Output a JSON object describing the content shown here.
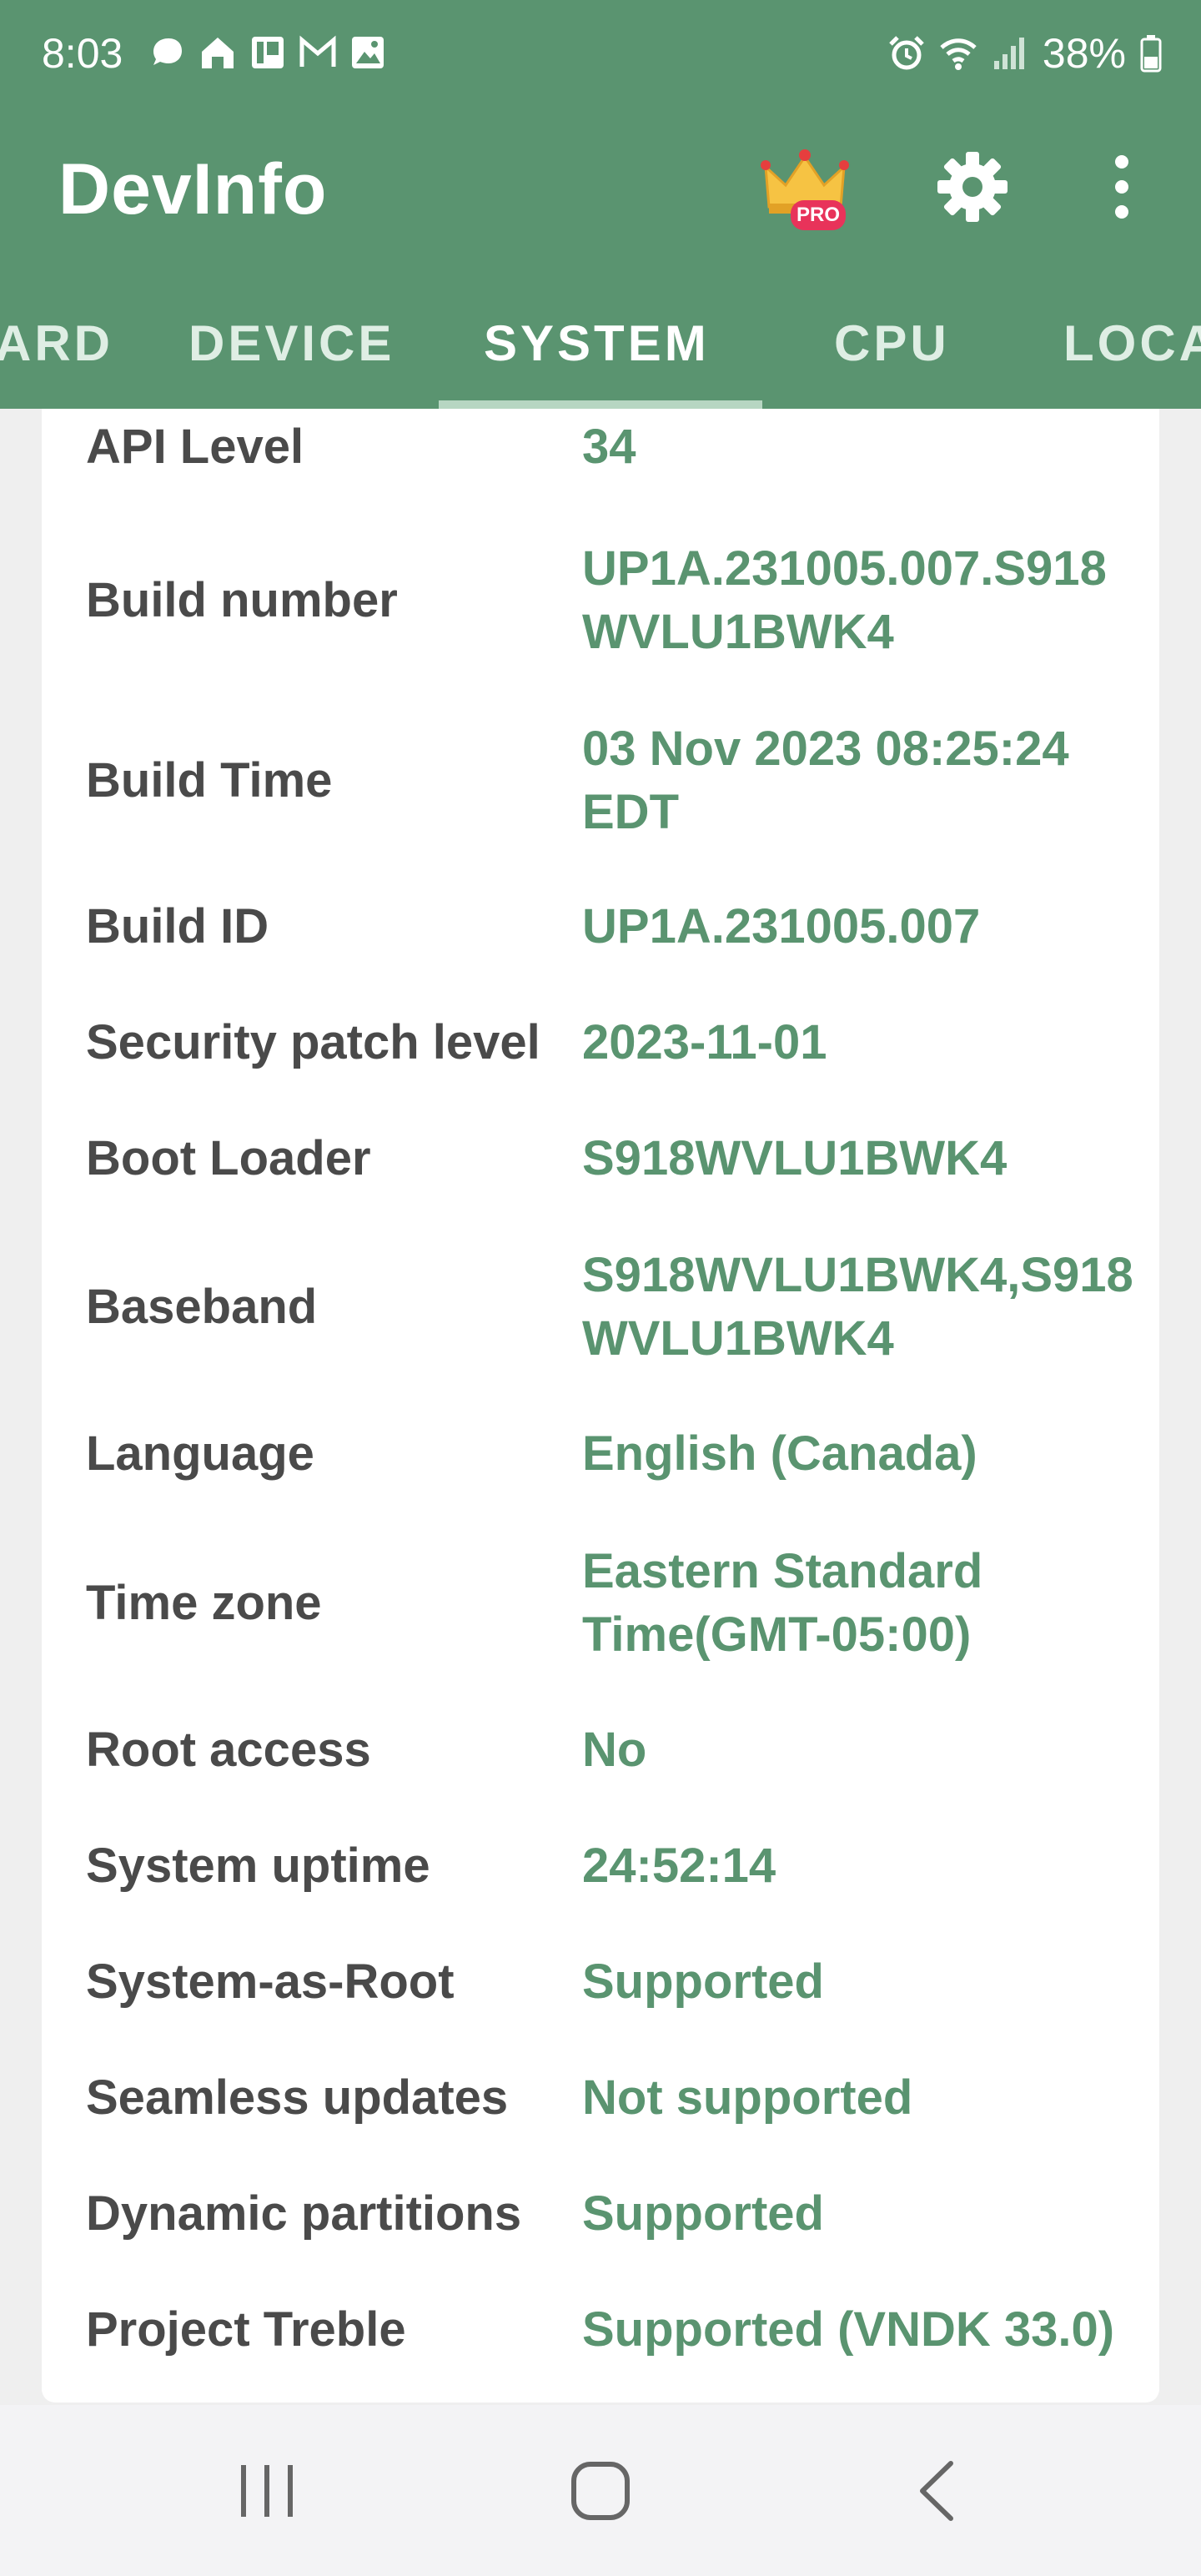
{
  "status_bar": {
    "time": "8:03",
    "battery_text": "38%",
    "notification_icons": [
      "chat-bubble-icon",
      "home-icon",
      "message-icon",
      "gmail-icon",
      "gallery-icon"
    ],
    "system_icons": [
      "alarm-icon",
      "wifi-icon",
      "signal-icon",
      "battery-icon"
    ]
  },
  "app_bar": {
    "title": "DevInfo",
    "pro_badge": "PRO"
  },
  "tabs": [
    {
      "label": "ARD",
      "active": false
    },
    {
      "label": "DEVICE",
      "active": false
    },
    {
      "label": "SYSTEM",
      "active": true
    },
    {
      "label": "CPU",
      "active": false
    },
    {
      "label": "LOCA",
      "active": false
    }
  ],
  "system_info": [
    {
      "key": "API Level",
      "value": "34"
    },
    {
      "key": "Build number",
      "value": "UP1A.231005.007.S918WVLU1BWK4"
    },
    {
      "key": "Build Time",
      "value": "03 Nov 2023 08:25:24 EDT"
    },
    {
      "key": "Build ID",
      "value": "UP1A.231005.007"
    },
    {
      "key": "Security patch level",
      "value": "2023-11-01"
    },
    {
      "key": "Boot Loader",
      "value": "S918WVLU1BWK4"
    },
    {
      "key": "Baseband",
      "value": "S918WVLU1BWK4,S918WVLU1BWK4"
    },
    {
      "key": "Language",
      "value": "English (Canada)"
    },
    {
      "key": "Time zone",
      "value": "Eastern Standard Time(GMT-05:00)"
    },
    {
      "key": "Root access",
      "value": "No"
    },
    {
      "key": "System uptime",
      "value": "24:52:14"
    },
    {
      "key": "System-as-Root",
      "value": "Supported"
    },
    {
      "key": "Seamless updates",
      "value": "Not supported"
    },
    {
      "key": "Dynamic partitions",
      "value": "Supported"
    },
    {
      "key": "Project Treble",
      "value": "Supported (VNDK 33.0)"
    }
  ],
  "colors": {
    "primary": "#5a9470",
    "value_text": "#5a9470",
    "label_text": "#4a4a4a",
    "background": "#efefef"
  }
}
